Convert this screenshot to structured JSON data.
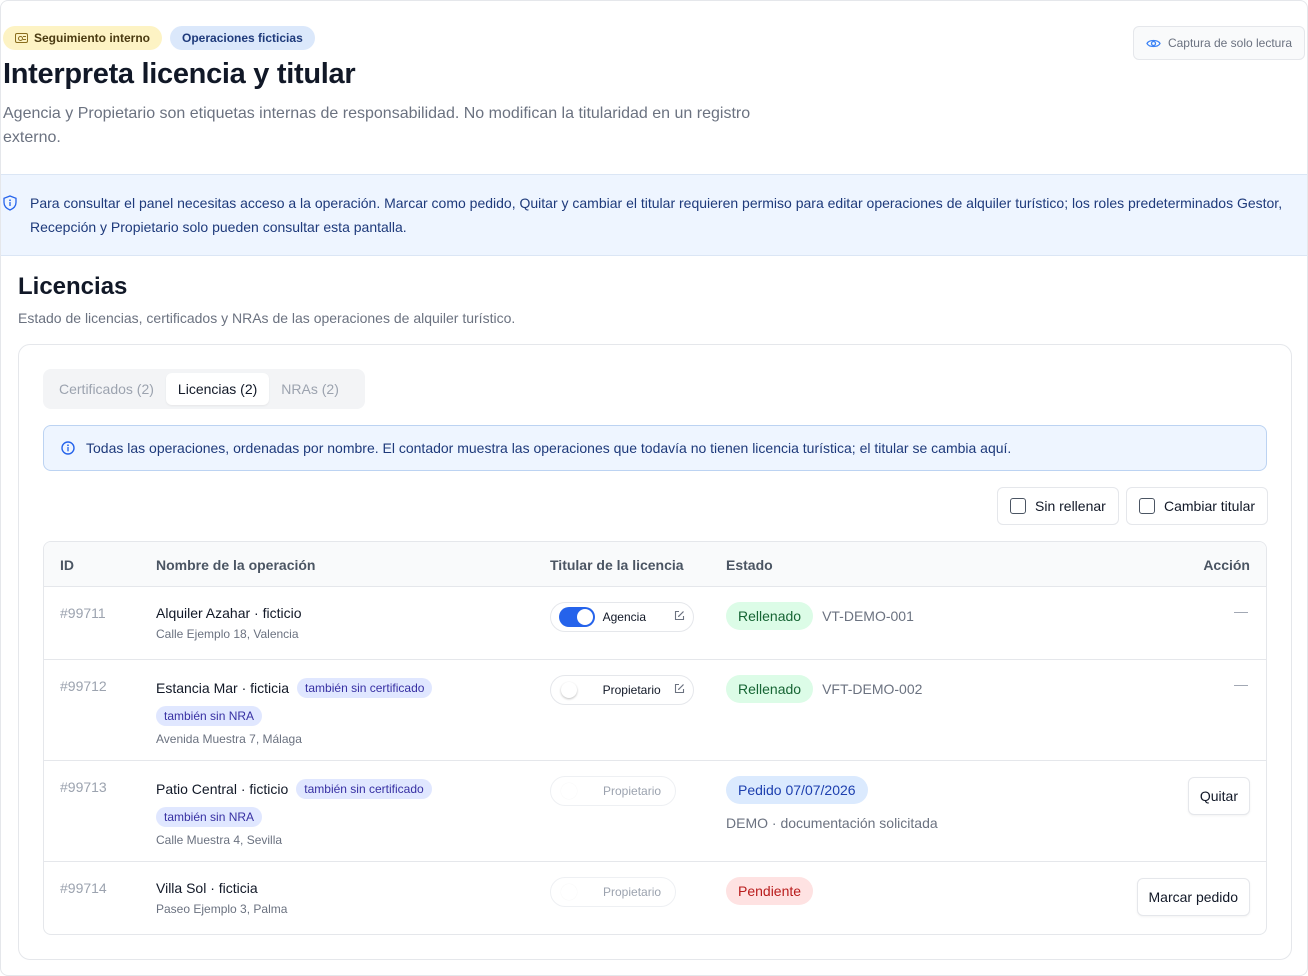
{
  "header": {
    "badges": [
      "Seguimiento interno",
      "Operaciones ficticias"
    ],
    "readonly_label": "Captura de solo lectura",
    "title": "Interpreta licencia y titular",
    "subtitle": "Agencia y Propietario son etiquetas internas de responsabilidad. No modifican la titularidad en un registro externo."
  },
  "permission_notice": "Para consultar el panel necesitas acceso a la operación. Marcar como pedido, Quitar y cambiar el titular requieren permiso para editar operaciones de alquiler turístico; los roles predeterminados Gestor, Recepción y Propietario solo pueden consultar esta pantalla.",
  "section": {
    "title": "Licencias",
    "subtitle": "Estado de licencias, certificados y NRAs de las operaciones de alquiler turístico."
  },
  "tabs": [
    {
      "label": "Certificados (2)",
      "active": false
    },
    {
      "label": "Licencias (2)",
      "active": true
    },
    {
      "label": "NRAs (2)",
      "active": false
    }
  ],
  "info_notice": "Todas las operaciones, ordenadas por nombre. El contador muestra las operaciones que todavía no tienen licencia turística; el titular se cambia aquí.",
  "filters": {
    "unfilled": "Sin rellenar",
    "change_holder": "Cambiar titular"
  },
  "table": {
    "columns": {
      "id": "ID",
      "name": "Nombre de la operación",
      "holder": "Titular de la licencia",
      "status": "Estado",
      "action": "Acción"
    },
    "rows": [
      {
        "id": "#99711",
        "name": "Alquiler Azahar · ficticio",
        "tags": [],
        "address": "Calle Ejemplo 18, Valencia",
        "holder": "Agencia",
        "holder_on": true,
        "holder_editable": true,
        "status": "Rellenado",
        "status_kind": "green",
        "code": "VT-DEMO-001",
        "note": "",
        "action": "—"
      },
      {
        "id": "#99712",
        "name": "Estancia Mar · ficticia",
        "tags": [
          "también sin certificado",
          "también sin NRA"
        ],
        "address": "Avenida Muestra 7, Málaga",
        "holder": "Propietario",
        "holder_on": false,
        "holder_editable": true,
        "status": "Rellenado",
        "status_kind": "green",
        "code": "VFT-DEMO-002",
        "note": "",
        "action": "—"
      },
      {
        "id": "#99713",
        "name": "Patio Central · ficticio",
        "tags": [
          "también sin certificado",
          "también sin NRA"
        ],
        "address": "Calle Muestra 4, Sevilla",
        "holder": "Propietario",
        "holder_on": false,
        "holder_editable": false,
        "status": "Pedido 07/07/2026",
        "status_kind": "blue",
        "code": "",
        "note": "DEMO · documentación solicitada",
        "action": "Quitar"
      },
      {
        "id": "#99714",
        "name": "Villa Sol · ficticia",
        "tags": [],
        "address": "Paseo Ejemplo 3, Palma",
        "holder": "Propietario",
        "holder_on": false,
        "holder_editable": false,
        "status": "Pendiente",
        "status_kind": "red",
        "code": "",
        "note": "",
        "action": "Marcar pedido"
      }
    ]
  }
}
